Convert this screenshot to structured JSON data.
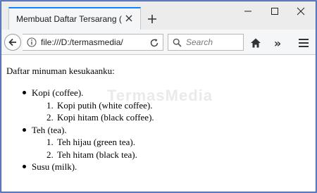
{
  "window": {
    "tab_title": "Membuat Daftar Tersarang (N…",
    "new_tab_symbol": "+",
    "minimize_symbol": "—",
    "maximize_symbol": "☐",
    "close_symbol": "✕"
  },
  "toolbar": {
    "url": "file:///D:/termasmedia/",
    "search_placeholder": "Search",
    "more_tools_symbol": "»"
  },
  "page": {
    "intro": "Daftar minuman kesukaanku:",
    "items": [
      {
        "label": "Kopi (coffee).",
        "sub": [
          {
            "num": "1.",
            "label": "Kopi putih (white coffee)."
          },
          {
            "num": "2.",
            "label": "Kopi hitam (black coffee)."
          }
        ]
      },
      {
        "label": "Teh (tea).",
        "sub": [
          {
            "num": "1.",
            "label": "Teh hijau (green tea)."
          },
          {
            "num": "2.",
            "label": "Teh hitam (black tea)."
          }
        ]
      },
      {
        "label": "Susu (milk).",
        "sub": []
      }
    ],
    "watermark": "TermasMedia"
  },
  "colors": {
    "accent": "#0a84ff",
    "desktop_border": "#6b86c9"
  },
  "icons": [
    "close-icon",
    "plus-icon",
    "minimize-icon",
    "maximize-icon",
    "back-arrow-icon",
    "info-icon",
    "reload-icon",
    "search-icon",
    "home-icon",
    "chevron-double-right-icon",
    "hamburger-menu-icon"
  ]
}
